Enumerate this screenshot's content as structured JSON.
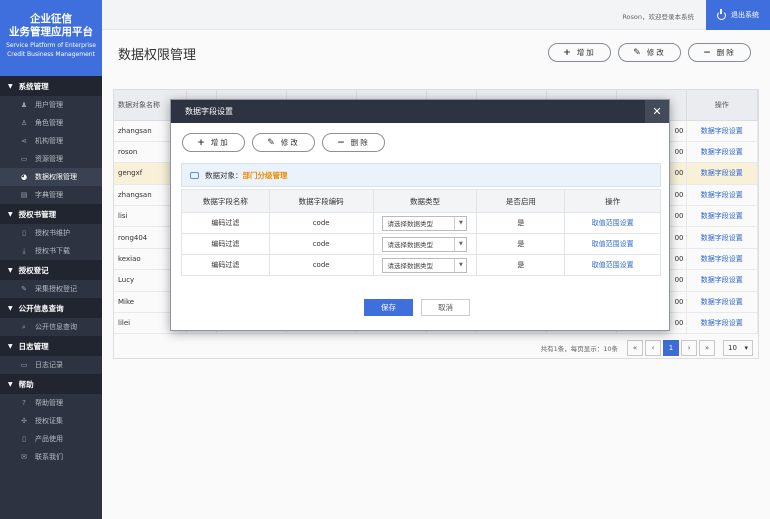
{
  "app": {
    "title_line1": "企业征信",
    "title_line2": "业务管理应用平台",
    "subtitle_line1": "Service Platform of Enterprise",
    "subtitle_line2": "Credit Business Management"
  },
  "topbar": {
    "welcome": "Roson，欢迎登录本系统",
    "logout": "退出系统"
  },
  "sidebar": {
    "sections": [
      {
        "label": "系统管理",
        "items": [
          {
            "label": "用户管理",
            "icon": "user-icon",
            "glyph": "♟"
          },
          {
            "label": "角色管理",
            "icon": "role-icon",
            "glyph": "♙"
          },
          {
            "label": "机构管理",
            "icon": "org-icon",
            "glyph": "⋖"
          },
          {
            "label": "资源管理",
            "icon": "folder-icon",
            "glyph": "▭"
          },
          {
            "label": "数据权限管理",
            "icon": "data-permission-icon",
            "glyph": "◕",
            "active": true
          },
          {
            "label": "字典管理",
            "icon": "dictionary-icon",
            "glyph": "▤"
          }
        ]
      },
      {
        "label": "授权书管理",
        "items": [
          {
            "label": "授权书维护",
            "icon": "document-icon",
            "glyph": "▯"
          },
          {
            "label": "授权书下载",
            "icon": "download-icon",
            "glyph": "⤓"
          }
        ]
      },
      {
        "label": "授权登记",
        "items": [
          {
            "label": "采集授权登记",
            "icon": "pen-icon",
            "glyph": "✎"
          }
        ]
      },
      {
        "label": "公开信息查询",
        "items": [
          {
            "label": "公开信息查询",
            "icon": "search-icon",
            "glyph": "⌕"
          }
        ]
      },
      {
        "label": "日志管理",
        "items": [
          {
            "label": "日志记录",
            "icon": "log-icon",
            "glyph": "▭"
          }
        ]
      },
      {
        "label": "帮助",
        "items": [
          {
            "label": "帮助管理",
            "icon": "help-icon",
            "glyph": "?"
          },
          {
            "label": "授权证集",
            "icon": "certificate-icon",
            "glyph": "✣"
          },
          {
            "label": "产品使用",
            "icon": "phone-icon",
            "glyph": "▯"
          },
          {
            "label": "联系我们",
            "icon": "mail-icon",
            "glyph": "✉"
          }
        ]
      }
    ]
  },
  "page": {
    "title": "数据权限管理",
    "add": "增加",
    "edit": "修改",
    "delete": "删除"
  },
  "table": {
    "col_name": "数据对象名称",
    "col_action": "操作",
    "rows": [
      {
        "name": "zhangsan",
        "num": "00",
        "action": "数据字段设置"
      },
      {
        "name": "roson",
        "num": "00",
        "action": "数据字段设置"
      },
      {
        "name": "gengxf",
        "num": "00",
        "action": "数据字段设置",
        "highlight": true
      },
      {
        "name": "zhangsan",
        "num": "00",
        "action": "数据字段设置"
      },
      {
        "name": "lisi",
        "num": "00",
        "action": "数据字段设置"
      },
      {
        "name": "rong404",
        "num": "00",
        "action": "数据字段设置"
      },
      {
        "name": "kexiao",
        "num": "00",
        "action": "数据字段设置"
      },
      {
        "name": "Lucy",
        "num": "00",
        "action": "数据字段设置"
      },
      {
        "name": "Mike",
        "num": "00",
        "action": "数据字段设置"
      },
      {
        "name": "lilei",
        "num": "00",
        "action": "数据字段设置"
      }
    ]
  },
  "pager": {
    "info": "共有1条，每页显示：10条",
    "first": "«",
    "prev": "‹",
    "current": "1",
    "next": "›",
    "last": "»",
    "page_size": "10"
  },
  "modal": {
    "title": "数据字段设置",
    "close": "✕",
    "add": "增加",
    "edit": "修改",
    "delete": "删除",
    "object_label": "数据对象：",
    "object_value": "部门分级管理",
    "columns": [
      "数据字段名称",
      "数据字段编码",
      "数据类型",
      "是否启用",
      "操作"
    ],
    "rows": [
      {
        "name": "编码过滤",
        "code": "code",
        "type_placeholder": "请选择数据类型",
        "enabled": "是",
        "action": "取值范围设置"
      },
      {
        "name": "编码过滤",
        "code": "code",
        "type_placeholder": "请选择数据类型",
        "enabled": "是",
        "action": "取值范围设置"
      },
      {
        "name": "编码过滤",
        "code": "code",
        "type_placeholder": "请选择数据类型",
        "enabled": "是",
        "action": "取值范围设置"
      }
    ],
    "save": "保存",
    "cancel": "取消"
  }
}
